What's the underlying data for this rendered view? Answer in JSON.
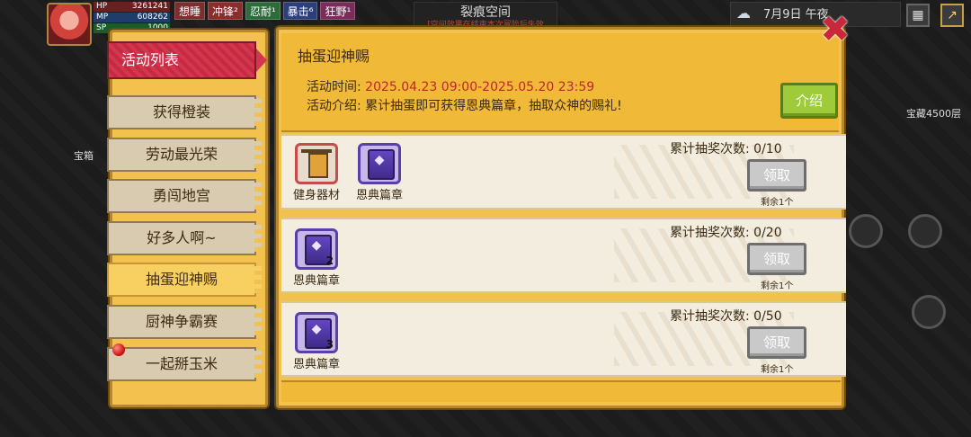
{
  "hud": {
    "hp_label": "HP",
    "hp_value": "3261241",
    "mp_label": "MP",
    "mp_value": "608262",
    "sp_label": "SP",
    "sp_value": "1000",
    "buffs": [
      {
        "label": "想睡",
        "color": "#7a2f2f"
      },
      {
        "label": "冲锋²",
        "color": "#8a2d2d"
      },
      {
        "label": "忍耐¹",
        "color": "#2d6b3a"
      },
      {
        "label": "暴击⁶",
        "color": "#2d3f7a"
      },
      {
        "label": "狂野¹",
        "color": "#7a2d5a"
      }
    ],
    "scene_title": "裂痕空间",
    "scene_sub": "[空间效果在结束本次冒险后失效",
    "date": "7月9日  午夜",
    "right_label": "宝藏4500层",
    "left_label": "宝箱"
  },
  "menu": {
    "header": "活动列表",
    "items": [
      {
        "label": "获得橙装"
      },
      {
        "label": "劳动最光荣"
      },
      {
        "label": "勇闯地宫"
      },
      {
        "label": "好多人啊~"
      },
      {
        "label": "抽蛋迎神赐"
      },
      {
        "label": "厨神争霸赛"
      },
      {
        "label": "一起掰玉米"
      }
    ],
    "active_index": 4
  },
  "event": {
    "title": "抽蛋迎神赐",
    "time_label": "活动时间:",
    "time_value": "2025.04.23 09:00-2025.05.20 23:59",
    "intro_label": "活动介绍:",
    "intro_value": "累计抽蛋即可获得恩典篇章，抽取众神的赐礼!",
    "intro_button": "介绍"
  },
  "rewards": [
    {
      "count_label": "累计抽奖次数: 0/10",
      "claim": "领取",
      "remain": "剩余1个",
      "items": [
        {
          "name": "健身器材",
          "icon": "gym-equipment-icon",
          "qty": ""
        },
        {
          "name": "恩典篇章",
          "icon": "grace-chapter-icon",
          "qty": ""
        }
      ]
    },
    {
      "count_label": "累计抽奖次数: 0/20",
      "claim": "领取",
      "remain": "剩余1个",
      "items": [
        {
          "name": "恩典篇章",
          "icon": "grace-chapter-icon",
          "qty": "2"
        }
      ]
    },
    {
      "count_label": "累计抽奖次数: 0/50",
      "claim": "领取",
      "remain": "剩余1个",
      "items": [
        {
          "name": "恩典篇章",
          "icon": "grace-chapter-icon",
          "qty": "3"
        }
      ]
    }
  ],
  "colors": {
    "panel": "#f2c14e",
    "accent_red": "#c0262b",
    "header_red": "#d4364d",
    "intro_green": "#9ecb3a",
    "claim_grey": "#c9c9c9"
  }
}
